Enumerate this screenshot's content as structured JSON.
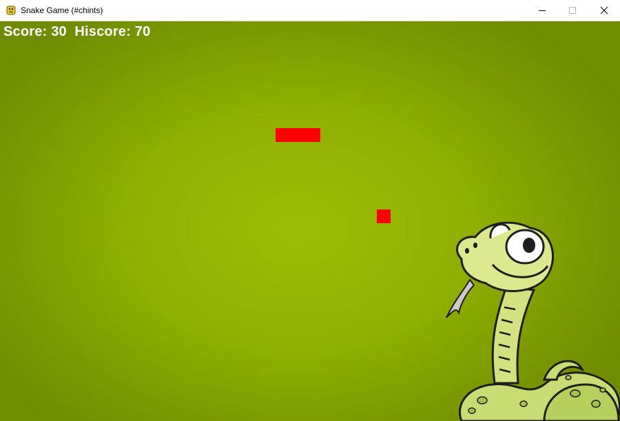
{
  "window": {
    "title": "Snake Game (#chints)",
    "icon": "python-game-icon",
    "controls": [
      "minimize-icon",
      "maximize-icon",
      "close-icon"
    ]
  },
  "game": {
    "score_text": "Score: 30  Hiscore: 70",
    "score": 30,
    "hiscore": 70,
    "colors": {
      "background": "#8fb002",
      "snake": "#ff0000",
      "food": "#ff0000",
      "score_text": "#ffffff"
    },
    "snake_length_segments": 3,
    "mascot": "cartoon-snake-illustration"
  }
}
